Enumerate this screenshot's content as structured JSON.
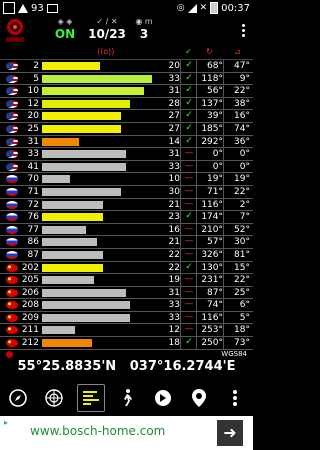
{
  "statusbar": {
    "badge": "93",
    "time": "00:37"
  },
  "header": {
    "logo_label": "ANDROIDS",
    "status_value": "ON",
    "sats_value": "10/23",
    "m_label": "m",
    "m_value": "3"
  },
  "table": {
    "signal_header": "((o))",
    "rows": [
      {
        "flag": "us",
        "prn": "2",
        "bar": 0.53,
        "color": "#f0f000",
        "snr": "20",
        "fix": "✓",
        "az": "68°",
        "el": "47°"
      },
      {
        "flag": "us",
        "prn": "5",
        "bar": 1.0,
        "color": "#b8f03c",
        "snr": "33",
        "fix": "✓",
        "az": "118°",
        "el": "9°"
      },
      {
        "flag": "us",
        "prn": "10",
        "bar": 0.93,
        "color": "#c6f032",
        "snr": "31",
        "fix": "✓",
        "az": "56°",
        "el": "22°"
      },
      {
        "flag": "us",
        "prn": "12",
        "bar": 0.8,
        "color": "#e0f000",
        "snr": "28",
        "fix": "✓",
        "az": "137°",
        "el": "38°"
      },
      {
        "flag": "us",
        "prn": "20",
        "bar": 0.72,
        "color": "#f0f000",
        "snr": "27",
        "fix": "✓",
        "az": "39°",
        "el": "16°"
      },
      {
        "flag": "us",
        "prn": "25",
        "bar": 0.72,
        "color": "#f0f000",
        "snr": "27",
        "fix": "✓",
        "az": "185°",
        "el": "74°"
      },
      {
        "flag": "us",
        "prn": "31",
        "bar": 0.34,
        "color": "#f08800",
        "snr": "14",
        "fix": "✓",
        "az": "292°",
        "el": "36°"
      },
      {
        "flag": "us",
        "prn": "33",
        "bar": 0.76,
        "color": "#bdbdbd",
        "snr": "31",
        "fix": "—",
        "az": "0°",
        "el": "0°"
      },
      {
        "flag": "us",
        "prn": "41",
        "bar": 0.76,
        "color": "#bdbdbd",
        "snr": "33",
        "fix": "—",
        "az": "0°",
        "el": "0°"
      },
      {
        "flag": "ru",
        "prn": "70",
        "bar": 0.25,
        "color": "#bdbdbd",
        "snr": "10",
        "fix": "—",
        "az": "19°",
        "el": "19°"
      },
      {
        "flag": "ru",
        "prn": "71",
        "bar": 0.72,
        "color": "#bdbdbd",
        "snr": "30",
        "fix": "—",
        "az": "71°",
        "el": "22°"
      },
      {
        "flag": "ru",
        "prn": "72",
        "bar": 0.55,
        "color": "#bdbdbd",
        "snr": "21",
        "fix": "—",
        "az": "116°",
        "el": "2°"
      },
      {
        "flag": "ru",
        "prn": "76",
        "bar": 0.55,
        "color": "#f0f000",
        "snr": "23",
        "fix": "✓",
        "az": "174°",
        "el": "7°"
      },
      {
        "flag": "ru",
        "prn": "77",
        "bar": 0.4,
        "color": "#bdbdbd",
        "snr": "16",
        "fix": "—",
        "az": "210°",
        "el": "52°"
      },
      {
        "flag": "ru",
        "prn": "86",
        "bar": 0.5,
        "color": "#bdbdbd",
        "snr": "21",
        "fix": "—",
        "az": "57°",
        "el": "30°"
      },
      {
        "flag": "ru",
        "prn": "87",
        "bar": 0.55,
        "color": "#bdbdbd",
        "snr": "22",
        "fix": "—",
        "az": "326°",
        "el": "81°"
      },
      {
        "flag": "cn",
        "prn": "202",
        "bar": 0.55,
        "color": "#f0f000",
        "snr": "22",
        "fix": "✓",
        "az": "130°",
        "el": "15°"
      },
      {
        "flag": "cn",
        "prn": "205",
        "bar": 0.47,
        "color": "#bdbdbd",
        "snr": "19",
        "fix": "—",
        "az": "231°",
        "el": "22°"
      },
      {
        "flag": "cn",
        "prn": "206",
        "bar": 0.76,
        "color": "#bdbdbd",
        "snr": "31",
        "fix": "—",
        "az": "87°",
        "el": "25°"
      },
      {
        "flag": "cn",
        "prn": "208",
        "bar": 0.8,
        "color": "#bdbdbd",
        "snr": "33",
        "fix": "—",
        "az": "74°",
        "el": "6°"
      },
      {
        "flag": "cn",
        "prn": "209",
        "bar": 0.8,
        "color": "#bdbdbd",
        "snr": "33",
        "fix": "—",
        "az": "116°",
        "el": "5°"
      },
      {
        "flag": "cn",
        "prn": "211",
        "bar": 0.3,
        "color": "#bdbdbd",
        "snr": "12",
        "fix": "—",
        "az": "253°",
        "el": "18°"
      },
      {
        "flag": "cn",
        "prn": "212",
        "bar": 0.45,
        "color": "#f08800",
        "snr": "18",
        "fix": "✓",
        "az": "250°",
        "el": "73°"
      }
    ]
  },
  "coords": {
    "lat": "55°25.8835'N",
    "lon": "037°16.2744'E",
    "datum": "WGS84"
  },
  "ad": {
    "url": "www.bosch-home.com",
    "arrow": "➜"
  }
}
